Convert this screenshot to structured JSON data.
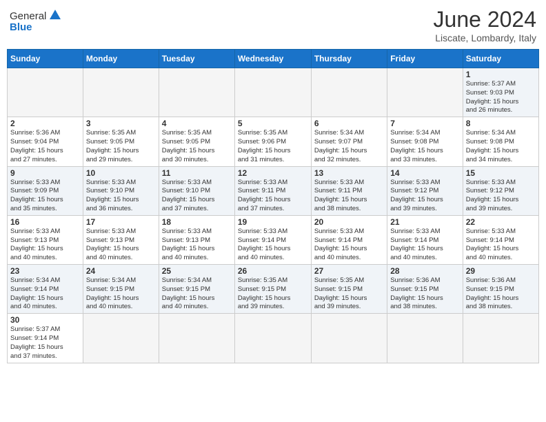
{
  "header": {
    "logo_general": "General",
    "logo_blue": "Blue",
    "month_title": "June 2024",
    "subtitle": "Liscate, Lombardy, Italy"
  },
  "days_of_week": [
    "Sunday",
    "Monday",
    "Tuesday",
    "Wednesday",
    "Thursday",
    "Friday",
    "Saturday"
  ],
  "weeks": [
    [
      {
        "day": "",
        "info": "",
        "empty": true
      },
      {
        "day": "",
        "info": "",
        "empty": true
      },
      {
        "day": "",
        "info": "",
        "empty": true
      },
      {
        "day": "",
        "info": "",
        "empty": true
      },
      {
        "day": "",
        "info": "",
        "empty": true
      },
      {
        "day": "",
        "info": "",
        "empty": true
      },
      {
        "day": "1",
        "info": "Sunrise: 5:37 AM\nSunset: 9:03 PM\nDaylight: 15 hours\nand 26 minutes."
      }
    ],
    [
      {
        "day": "2",
        "info": "Sunrise: 5:36 AM\nSunset: 9:04 PM\nDaylight: 15 hours\nand 27 minutes."
      },
      {
        "day": "3",
        "info": "Sunrise: 5:35 AM\nSunset: 9:05 PM\nDaylight: 15 hours\nand 29 minutes."
      },
      {
        "day": "4",
        "info": "Sunrise: 5:35 AM\nSunset: 9:05 PM\nDaylight: 15 hours\nand 30 minutes."
      },
      {
        "day": "5",
        "info": "Sunrise: 5:35 AM\nSunset: 9:06 PM\nDaylight: 15 hours\nand 31 minutes."
      },
      {
        "day": "6",
        "info": "Sunrise: 5:34 AM\nSunset: 9:07 PM\nDaylight: 15 hours\nand 32 minutes."
      },
      {
        "day": "7",
        "info": "Sunrise: 5:34 AM\nSunset: 9:08 PM\nDaylight: 15 hours\nand 33 minutes."
      },
      {
        "day": "8",
        "info": "Sunrise: 5:34 AM\nSunset: 9:08 PM\nDaylight: 15 hours\nand 34 minutes."
      }
    ],
    [
      {
        "day": "9",
        "info": "Sunrise: 5:33 AM\nSunset: 9:09 PM\nDaylight: 15 hours\nand 35 minutes."
      },
      {
        "day": "10",
        "info": "Sunrise: 5:33 AM\nSunset: 9:10 PM\nDaylight: 15 hours\nand 36 minutes."
      },
      {
        "day": "11",
        "info": "Sunrise: 5:33 AM\nSunset: 9:10 PM\nDaylight: 15 hours\nand 37 minutes."
      },
      {
        "day": "12",
        "info": "Sunrise: 5:33 AM\nSunset: 9:11 PM\nDaylight: 15 hours\nand 37 minutes."
      },
      {
        "day": "13",
        "info": "Sunrise: 5:33 AM\nSunset: 9:11 PM\nDaylight: 15 hours\nand 38 minutes."
      },
      {
        "day": "14",
        "info": "Sunrise: 5:33 AM\nSunset: 9:12 PM\nDaylight: 15 hours\nand 39 minutes."
      },
      {
        "day": "15",
        "info": "Sunrise: 5:33 AM\nSunset: 9:12 PM\nDaylight: 15 hours\nand 39 minutes."
      }
    ],
    [
      {
        "day": "16",
        "info": "Sunrise: 5:33 AM\nSunset: 9:13 PM\nDaylight: 15 hours\nand 40 minutes."
      },
      {
        "day": "17",
        "info": "Sunrise: 5:33 AM\nSunset: 9:13 PM\nDaylight: 15 hours\nand 40 minutes."
      },
      {
        "day": "18",
        "info": "Sunrise: 5:33 AM\nSunset: 9:13 PM\nDaylight: 15 hours\nand 40 minutes."
      },
      {
        "day": "19",
        "info": "Sunrise: 5:33 AM\nSunset: 9:14 PM\nDaylight: 15 hours\nand 40 minutes."
      },
      {
        "day": "20",
        "info": "Sunrise: 5:33 AM\nSunset: 9:14 PM\nDaylight: 15 hours\nand 40 minutes."
      },
      {
        "day": "21",
        "info": "Sunrise: 5:33 AM\nSunset: 9:14 PM\nDaylight: 15 hours\nand 40 minutes."
      },
      {
        "day": "22",
        "info": "Sunrise: 5:33 AM\nSunset: 9:14 PM\nDaylight: 15 hours\nand 40 minutes."
      }
    ],
    [
      {
        "day": "23",
        "info": "Sunrise: 5:34 AM\nSunset: 9:14 PM\nDaylight: 15 hours\nand 40 minutes."
      },
      {
        "day": "24",
        "info": "Sunrise: 5:34 AM\nSunset: 9:15 PM\nDaylight: 15 hours\nand 40 minutes."
      },
      {
        "day": "25",
        "info": "Sunrise: 5:34 AM\nSunset: 9:15 PM\nDaylight: 15 hours\nand 40 minutes."
      },
      {
        "day": "26",
        "info": "Sunrise: 5:35 AM\nSunset: 9:15 PM\nDaylight: 15 hours\nand 39 minutes."
      },
      {
        "day": "27",
        "info": "Sunrise: 5:35 AM\nSunset: 9:15 PM\nDaylight: 15 hours\nand 39 minutes."
      },
      {
        "day": "28",
        "info": "Sunrise: 5:36 AM\nSunset: 9:15 PM\nDaylight: 15 hours\nand 38 minutes."
      },
      {
        "day": "29",
        "info": "Sunrise: 5:36 AM\nSunset: 9:15 PM\nDaylight: 15 hours\nand 38 minutes."
      }
    ],
    [
      {
        "day": "30",
        "info": "Sunrise: 5:37 AM\nSunset: 9:14 PM\nDaylight: 15 hours\nand 37 minutes."
      },
      {
        "day": "",
        "info": "",
        "empty": true
      },
      {
        "day": "",
        "info": "",
        "empty": true
      },
      {
        "day": "",
        "info": "",
        "empty": true
      },
      {
        "day": "",
        "info": "",
        "empty": true
      },
      {
        "day": "",
        "info": "",
        "empty": true
      },
      {
        "day": "",
        "info": "",
        "empty": true
      }
    ]
  ]
}
